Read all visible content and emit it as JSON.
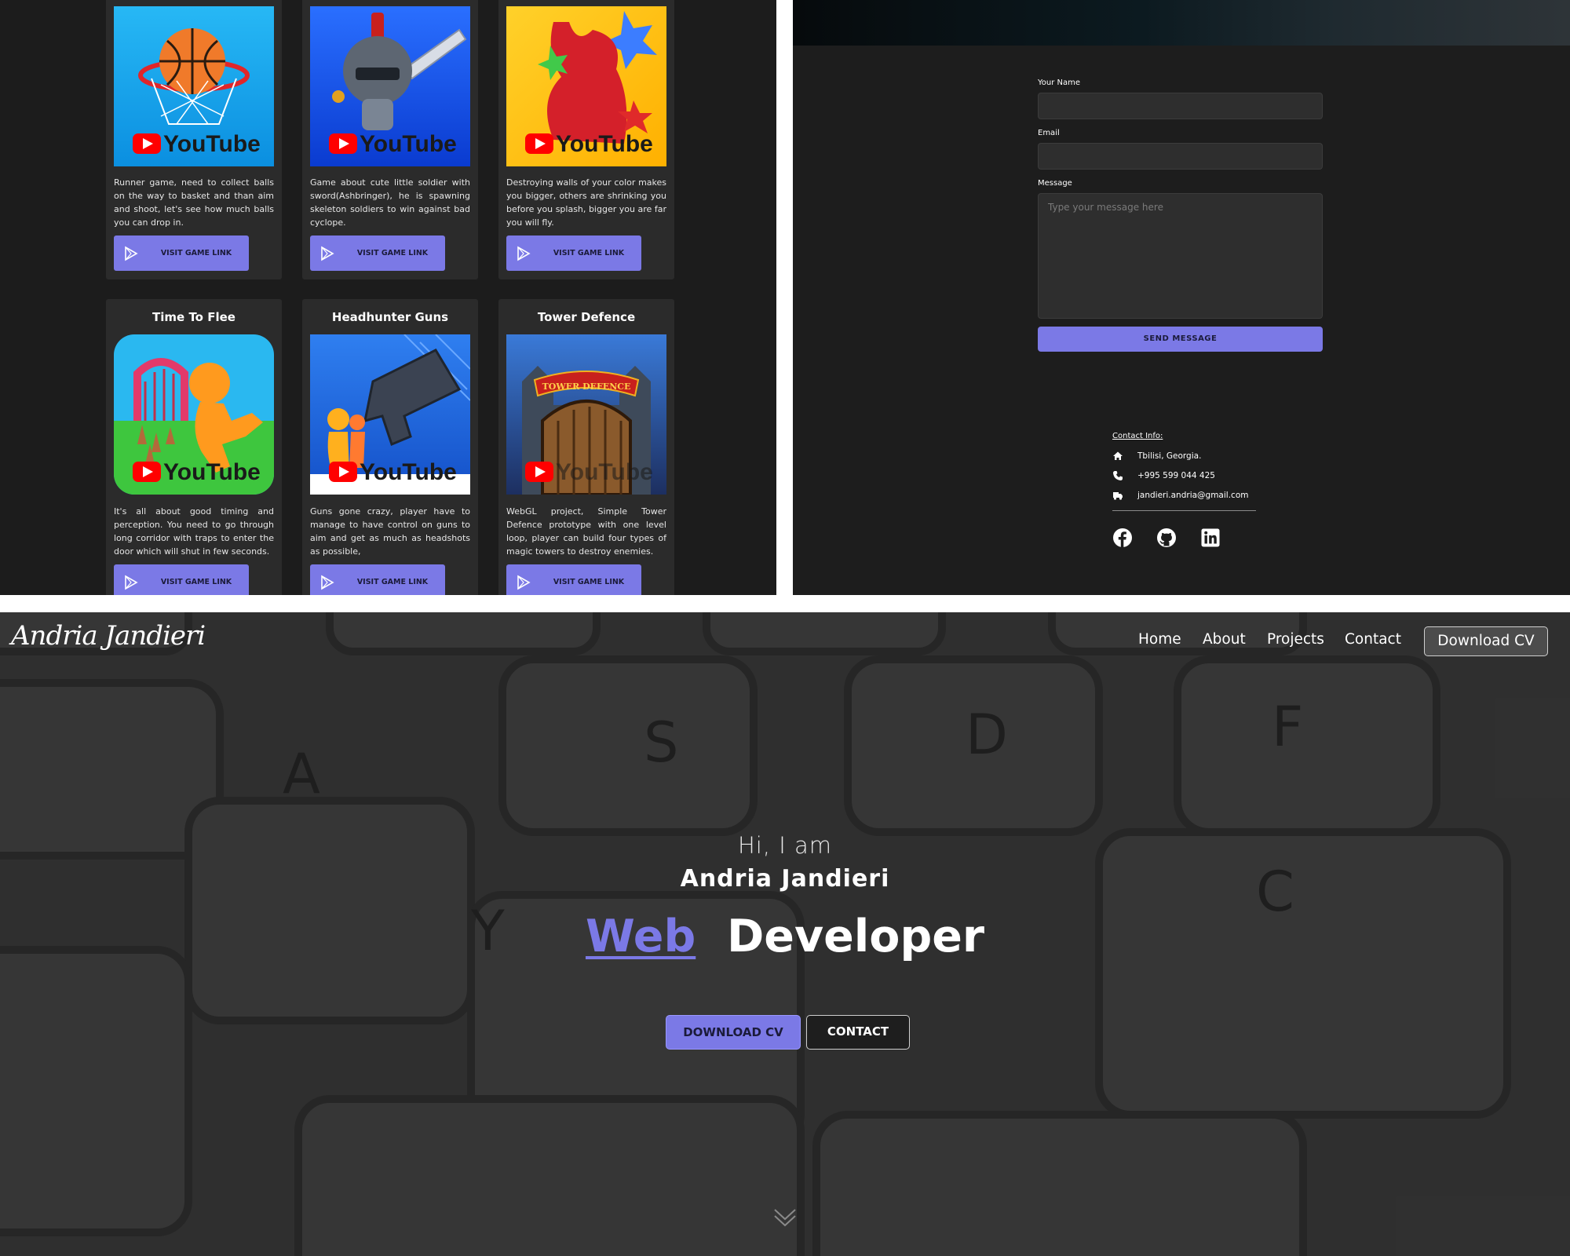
{
  "games": {
    "cards": [
      {
        "title": "",
        "desc": "Runner game, need to collect balls on the way to basket and than aim and shoot, let's see how much balls you can drop in.",
        "button": "VISIT GAME LINK",
        "thumb_text": "YouTube"
      },
      {
        "title": "",
        "desc": "Game about cute little soldier with sword(Ashbringer), he is spawning skeleton soldiers to win against bad cyclope.",
        "button": "VISIT GAME LINK",
        "thumb_text": "YouTube"
      },
      {
        "title": "",
        "desc": "Destroying walls of your color makes you bigger, others are shrinking you before you splash, bigger you are far you will fly.",
        "button": "VISIT GAME LINK",
        "thumb_text": "YouTube"
      },
      {
        "title": "Time To Flee",
        "desc": "It's all about good timing and perception. You need to go through long corridor with traps to enter the door which will shut in few seconds.",
        "button": "VISIT GAME LINK",
        "thumb_text": "YouTube"
      },
      {
        "title": "Headhunter Guns",
        "desc": "Guns gone crazy, player have to manage to have control on guns to aim and get as much as headshots as possible,",
        "button": "VISIT GAME LINK",
        "thumb_text": "YouTube"
      },
      {
        "title": "Tower Defence",
        "desc": "WebGL project, Simple Tower Defence prototype with one level loop, player can build four types of magic towers to destroy enemies.",
        "button": "VISIT GAME LINK",
        "thumb_text": "TOWER DEFENCE"
      }
    ]
  },
  "contact_form": {
    "name_label": "Your Name",
    "email_label": "Email",
    "message_label": "Message",
    "message_placeholder": "Type your message here",
    "send_label": "SEND  MESSAGE"
  },
  "contact_info": {
    "title": "Contact Info:",
    "address": "Tbilisi,  Georgia.",
    "phone": "+995 599 044 425",
    "email": "jandieri.andria@gmail.com",
    "socials": [
      "facebook-icon",
      "github-icon",
      "linkedin-icon"
    ]
  },
  "hero": {
    "logo": "Andria Jandieri",
    "nav": [
      "Home",
      "About",
      "Projects",
      "Contact"
    ],
    "nav_cv": "Download CV",
    "greeting": "Hi,  I am",
    "name": "Andria  Jandieri",
    "role_highlight": "Web",
    "role_rest": "Developer",
    "btn_cv": "DOWNLOAD CV",
    "btn_contact": "CONTACT"
  },
  "colors": {
    "accent": "#7b79e6",
    "dark_bg": "#1c1c1c",
    "card_bg": "#2b2b2b",
    "youtube_red": "#ff0000"
  }
}
